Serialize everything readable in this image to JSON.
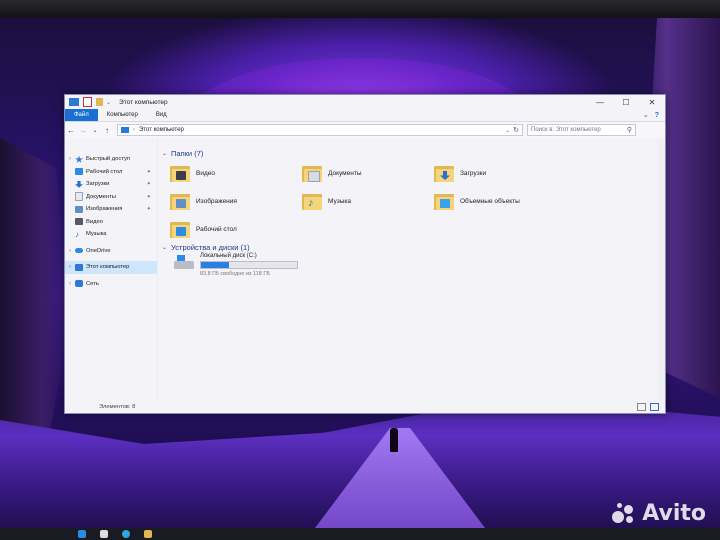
{
  "window": {
    "title": "Этот компьютер",
    "controls": {
      "minimize": "—",
      "maximize": "☐",
      "close": "✕"
    }
  },
  "ribbon": {
    "tabs": [
      {
        "label": "Файл",
        "active": true
      },
      {
        "label": "Компьютер",
        "active": false
      },
      {
        "label": "Вид",
        "active": false
      }
    ],
    "collapse_icon": "⌄",
    "help_icon": "?"
  },
  "address": {
    "back": "←",
    "forward": "→",
    "recent": "⌄",
    "up": "↑",
    "path": "Этот компьютер",
    "separator": "›",
    "dropdown": "⌄",
    "refresh": "↻",
    "search_placeholder": "Поиск в: Этот компьютер",
    "search_icon": "⚲"
  },
  "sidebar": {
    "items": [
      {
        "label": "Быстрый доступ",
        "icon": "star-icon",
        "color": "#2d7ad6",
        "pinned": false,
        "chevron": "›"
      },
      {
        "label": "Рабочий стол",
        "icon": "desktop-icon",
        "color": "#2a8be8",
        "pinned": true
      },
      {
        "label": "Загрузки",
        "icon": "download-icon",
        "color": "#2a6fd0",
        "pinned": true
      },
      {
        "label": "Документы",
        "icon": "documents-icon",
        "color": "#9aa0b0",
        "pinned": true
      },
      {
        "label": "Изображения",
        "icon": "pictures-icon",
        "color": "#5f8fc4",
        "pinned": true
      },
      {
        "label": "Видео",
        "icon": "video-icon",
        "color": "#555a66",
        "pinned": false
      },
      {
        "label": "Музыка",
        "icon": "music-icon",
        "color": "#2a6fd0",
        "pinned": false
      },
      {
        "label": "OneDrive",
        "icon": "onedrive-icon",
        "color": "#2a8be8",
        "pinned": false,
        "chevron": "›"
      },
      {
        "label": "Этот компьютер",
        "icon": "this-pc-icon",
        "color": "#2d7ad6",
        "pinned": false,
        "chevron": "›",
        "selected": true
      },
      {
        "label": "Сеть",
        "icon": "network-icon",
        "color": "#2d7ad6",
        "pinned": false,
        "chevron": "›"
      }
    ],
    "pin_glyph": "📌"
  },
  "folders": {
    "header": "Папки (7)",
    "chevron": "⌄",
    "items": [
      {
        "label": "Видео",
        "glyph_color": "#3c3f4a"
      },
      {
        "label": "Документы",
        "glyph_color": "#d8dbe6"
      },
      {
        "label": "Загрузки",
        "glyph_color": "#2a6fd0"
      },
      {
        "label": "Изображения",
        "glyph_color": "#5f8fc4"
      },
      {
        "label": "Музыка",
        "glyph_color": "#2a6fd0"
      },
      {
        "label": "Объемные объекты",
        "glyph_color": "#3aa0e8"
      },
      {
        "label": "Рабочий стол",
        "glyph_color": "#2a8be8"
      }
    ]
  },
  "devices": {
    "header": "Устройства и диски (1)",
    "chevron": "⌄",
    "drive": {
      "name": "Локальный диск (C:)",
      "free_text": "83,8 ГБ свободно из 118 ГБ",
      "used_fraction": 0.29
    }
  },
  "status": {
    "items_count": "Элементов: 8"
  },
  "colors": {
    "accent": "#1a6fd4",
    "selection": "#cde6fb",
    "group_header": "#1e3a8a"
  },
  "watermark": {
    "text": "Avito"
  }
}
